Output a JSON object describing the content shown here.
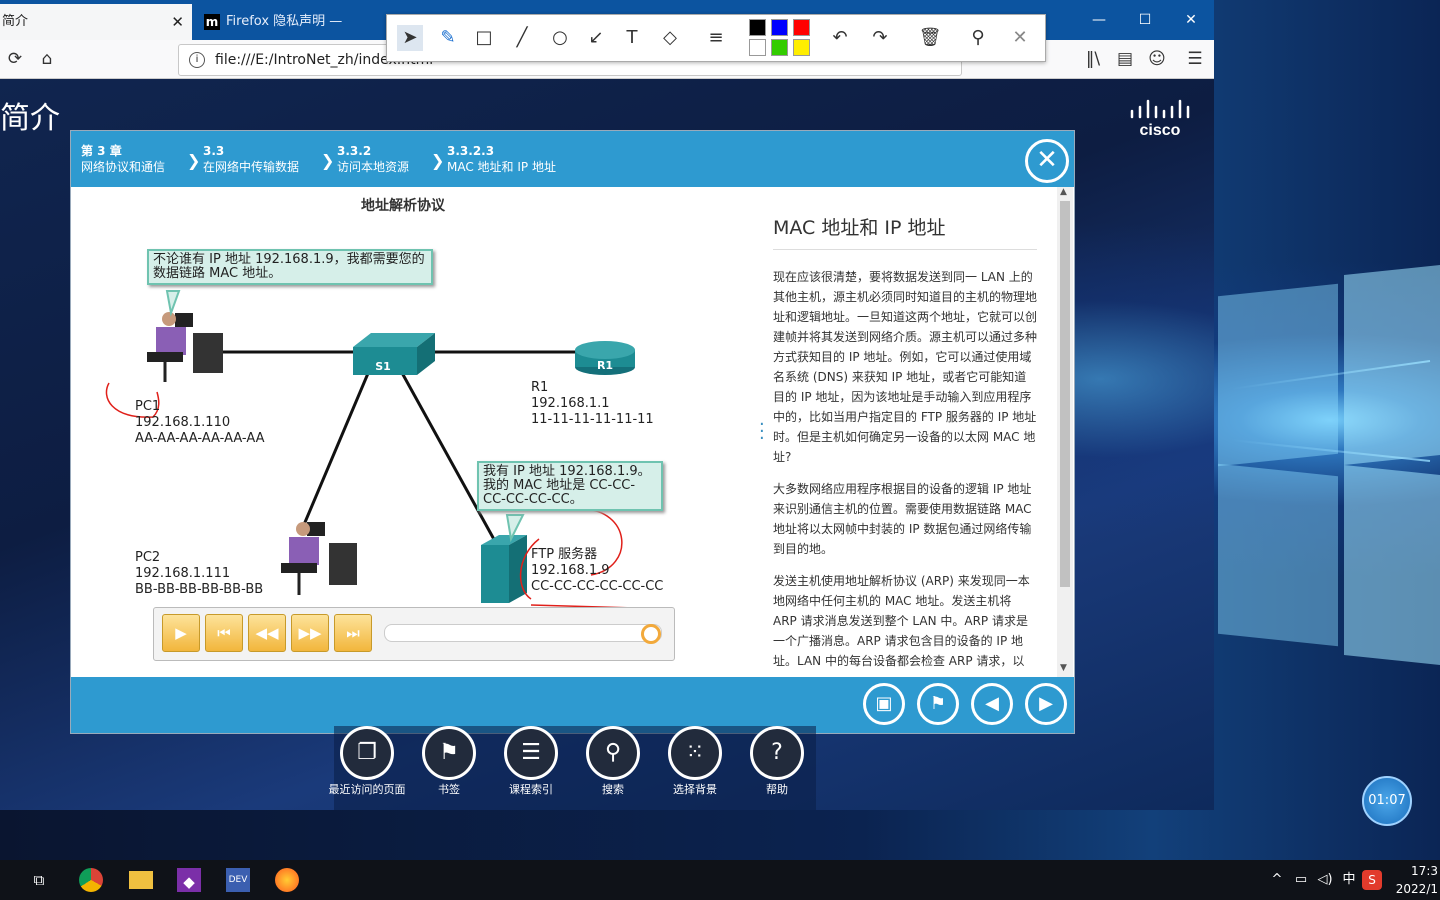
{
  "browser": {
    "tabs": [
      {
        "label": "简介"
      },
      {
        "label": "Firefox 隐私声明 — Mozilla"
      }
    ],
    "url": "file:///E:/IntroNet_zh/index.html",
    "window_controls": [
      "—",
      "☐",
      "✕"
    ]
  },
  "page": {
    "title": "简介",
    "brand": "cisco"
  },
  "breadcrumbs": [
    {
      "num": "第 3 章",
      "label": "网络协议和通信"
    },
    {
      "num": "3.3",
      "label": "在网络中传输数据"
    },
    {
      "num": "3.3.2",
      "label": "访问本地资源"
    },
    {
      "num": "3.3.2.3",
      "label": "MAC 地址和 IP 地址"
    }
  ],
  "diagram": {
    "title": "地址解析协议",
    "bubble1": "不论谁有 IP 地址 192.168.1.9，我都需要您的数据链路 MAC 地址。",
    "bubble2": "我有 IP 地址 192.168.1.9。我的 MAC 地址是 CC-CC-CC-CC-CC-CC。",
    "switch_label": "S1",
    "router_label": "R1",
    "pc1": {
      "name": "PC1",
      "ip": "192.168.1.110",
      "mac": "AA-AA-AA-AA-AA-AA"
    },
    "pc2": {
      "name": "PC2",
      "ip": "192.168.1.111",
      "mac": "BB-BB-BB-BB-BB-BB"
    },
    "r1": {
      "name": "R1",
      "ip": "192.168.1.1",
      "mac": "11-11-11-11-11-11"
    },
    "ftp": {
      "name": "FTP 服务器",
      "ip": "192.168.1.9",
      "mac": "CC-CC-CC-CC-CC-CC"
    }
  },
  "article": {
    "heading": "MAC 地址和 IP 地址",
    "p1": "现在应该很清楚，要将数据发送到同一 LAN 上的其他主机，源主机必须同时知道目的主机的物理地址和逻辑地址。一旦知道这两个地址，它就可以创建帧并将其发送到网络介质。源主机可以通过多种方式获知目的 IP 地址。例如，它可以通过使用域名系统 (DNS) 来获知 IP 地址，或者它可能知道目的 IP 地址，因为该地址是手动输入到应用程序中的，比如当用户指定目的 FTP 服务器的 IP 地址时。但是主机如何确定另一设备的以太网 MAC 地址?",
    "p2": "大多数网络应用程序根据目的设备的逻辑 IP 地址来识别通信主机的位置。需要使用数据链路 MAC 地址将以太网帧中封装的 IP 数据包通过网络传输到目的地。",
    "p3": "发送主机使用地址解析协议 (ARP) 来发现同一本地网络中任何主机的 MAC 地址。发送主机将 ARP 请求消息发送到整个 LAN 中。ARP 请求是一个广播消息。ARP 请求包含目的设备的 IP 地址。LAN 中的每台设备都会检查 ARP 请求，以"
  },
  "player": {
    "progress": 1.0
  },
  "dock": [
    {
      "label": "最近访问的页面",
      "icon": "pages-icon"
    },
    {
      "label": "书签",
      "icon": "bookmark-icon"
    },
    {
      "label": "课程索引",
      "icon": "list-icon"
    },
    {
      "label": "搜索",
      "icon": "search-icon"
    },
    {
      "label": "选择背景",
      "icon": "grid-icon"
    },
    {
      "label": "帮助",
      "icon": "help-icon"
    }
  ],
  "timer": "01:07",
  "taskbar": {
    "ime": "中",
    "time": "17:3",
    "date": "2022/1"
  },
  "annotation_colors": [
    "#000000",
    "#0000ff",
    "#ff0000",
    "#ffffff",
    "#33cc00",
    "#ffee00"
  ]
}
